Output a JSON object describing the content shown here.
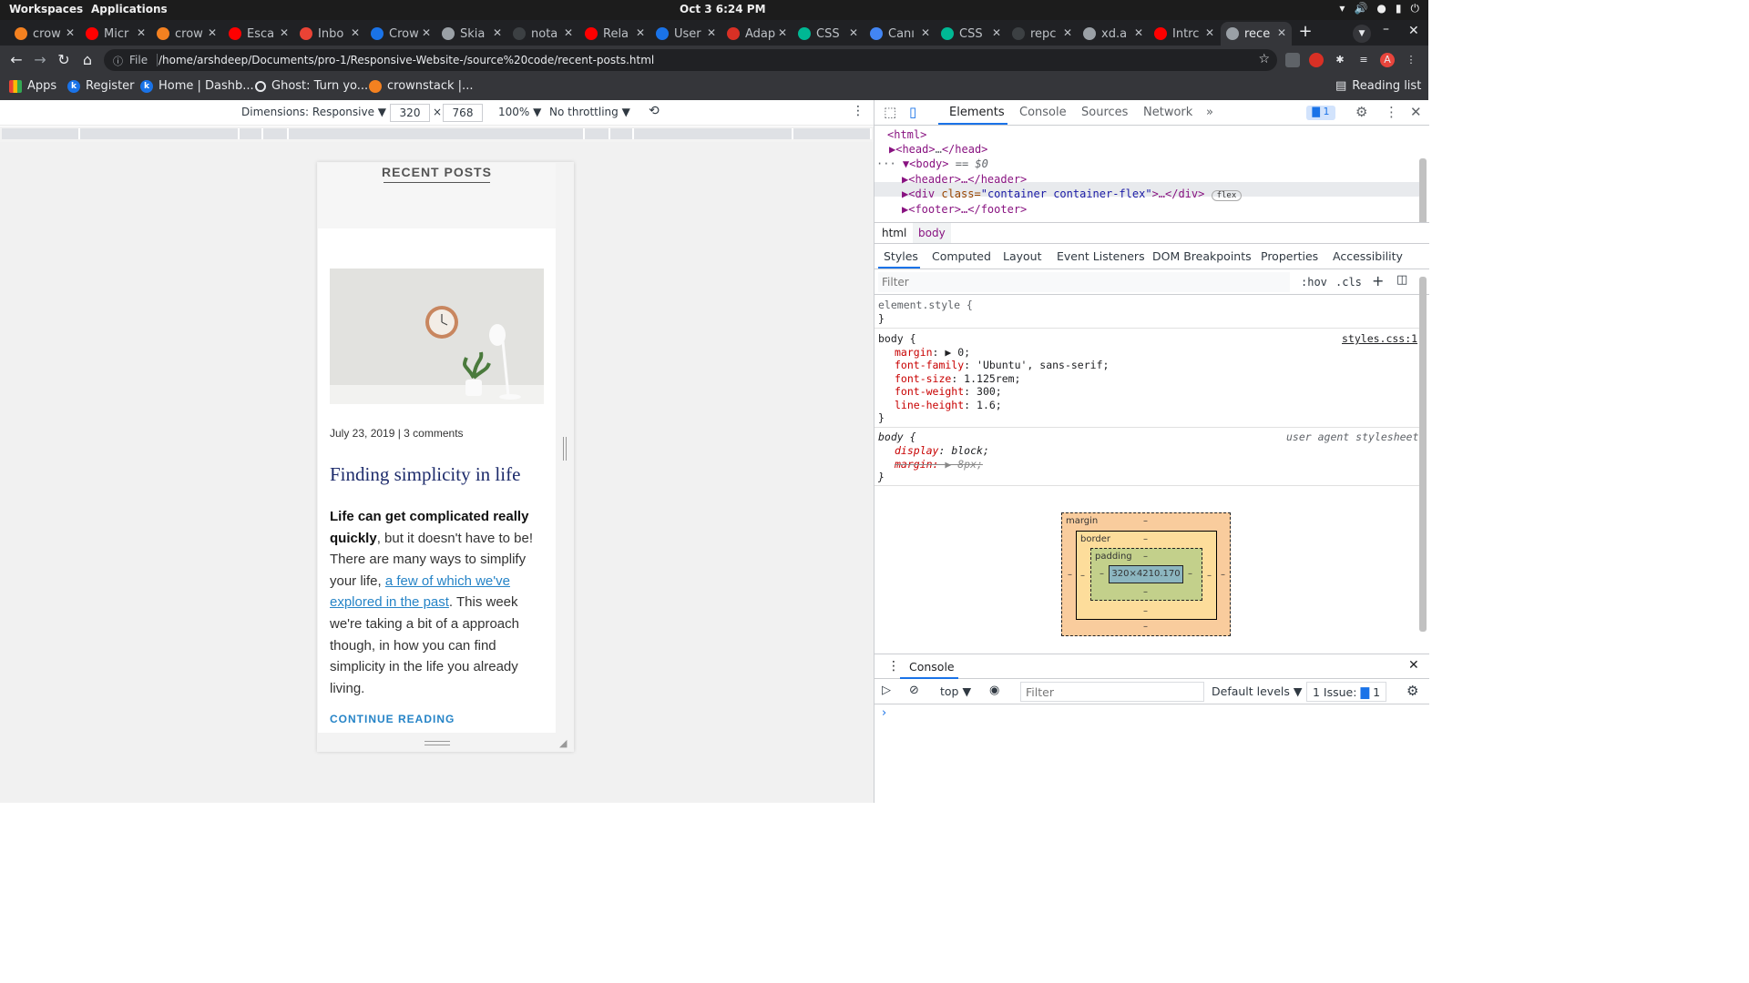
{
  "system": {
    "workspaces": "Workspaces",
    "applications": "Applications",
    "clock": "Oct 3   6:24 PM"
  },
  "tabs": [
    {
      "title": "crow",
      "color": "#f48120"
    },
    {
      "title": "Micr",
      "color": "#ff0000"
    },
    {
      "title": "crow",
      "color": "#f48120"
    },
    {
      "title": "Esca",
      "color": "#ff0000"
    },
    {
      "title": "Inbo",
      "color": "#ea4335"
    },
    {
      "title": "Crow",
      "color": "#1a73e8"
    },
    {
      "title": "Skia",
      "color": "#9aa0a6"
    },
    {
      "title": "nota",
      "color": "#3c4043"
    },
    {
      "title": "Rela",
      "color": "#ff0000"
    },
    {
      "title": "User",
      "color": "#1a73e8"
    },
    {
      "title": "Adap",
      "color": "#d93025"
    },
    {
      "title": "CSS",
      "color": "#00b894"
    },
    {
      "title": "Canı",
      "color": "#4285f4"
    },
    {
      "title": "CSS",
      "color": "#00b894"
    },
    {
      "title": "repc",
      "color": "#3c4043"
    },
    {
      "title": "xd.a",
      "color": "#9aa0a6"
    },
    {
      "title": "Intrc",
      "color": "#ff0000"
    },
    {
      "title": "rece",
      "color": "#9aa0a6",
      "active": true
    }
  ],
  "omnibox": {
    "info": "ⓘ",
    "file": "File",
    "url": "/home/arshdeep/Documents/pro-1/Responsive-Website-/source%20code/recent-posts.html"
  },
  "bookmarks": [
    {
      "label": "Apps",
      "color": "#4285f4"
    },
    {
      "label": "Register",
      "color": "#1a73e8"
    },
    {
      "label": "Home | Dashb...",
      "color": "#1a73e8"
    },
    {
      "label": "Ghost: Turn yo...",
      "color": "#3c4043"
    },
    {
      "label": "crownstack |...",
      "color": "#f48120"
    }
  ],
  "reading_list": "Reading list",
  "device": {
    "dimensions": "Dimensions: Responsive ▼",
    "width": "320",
    "times": "×",
    "height": "768",
    "zoom": "100% ▼",
    "throttle": "No throttling ▼"
  },
  "page": {
    "heading": "RECENT POSTS",
    "meta": "July 23, 2019 | 3 comments",
    "title": "Finding simplicity in life",
    "bold": "Life can get complicated really quickly",
    "text1": ", but it doesn't have to be! There are many ways to simplify your life, ",
    "link": "a few of which we've explored in the past",
    "text2": ". This week we're taking a bit of a approach though, in how you can find simplicity in the life you already living.",
    "continue": "CONTINUE READING"
  },
  "devtools": {
    "tabs": [
      "Elements",
      "Console",
      "Sources",
      "Network",
      "»"
    ],
    "issues": "1",
    "tree": {
      "html": "<html>",
      "head_open": "<head>",
      "head_dots": "…",
      "head_close": "</head>",
      "body": "<body>",
      "eq": " == $0",
      "header": "<header>…</header>",
      "div_open": "<div ",
      "div_attr": "class=",
      "div_val": "\"container container-flex\"",
      "div_close": ">…</div>",
      "flex": "flex",
      "footer": "<footer>…</footer>"
    },
    "crumbs": [
      "html",
      "body"
    ],
    "subtabs": [
      "Styles",
      "Computed",
      "Layout",
      "Event Listeners",
      "DOM Breakpoints",
      "Properties",
      "Accessibility"
    ],
    "filter": "Filter",
    "hov": ":hov",
    "cls": ".cls",
    "styles": {
      "element": "element.style {",
      "close": "}",
      "body_sel": "body {",
      "source": "styles.css:1",
      "rules": [
        {
          "p": "margin",
          "v": "▶ 0;"
        },
        {
          "p": "font-family",
          "v": "'Ubuntu', sans-serif;"
        },
        {
          "p": "font-size",
          "v": "1.125rem;"
        },
        {
          "p": "font-weight",
          "v": "300;"
        },
        {
          "p": "line-height",
          "v": "1.6;"
        }
      ],
      "ua_sel": "body {",
      "ua_source": "user agent stylesheet",
      "ua_rules": [
        {
          "p": "display",
          "v": "block;"
        },
        {
          "p": "margin:",
          "v": "▶ 8px;"
        }
      ]
    },
    "boxmodel": {
      "margin": "margin",
      "border": "border",
      "padding": "padding",
      "dash": "–",
      "content": "320×4210.170"
    },
    "console": {
      "title": "Console",
      "top": "top ▼",
      "filter": "Filter",
      "levels": "Default levels ▼",
      "issue": "1 Issue:",
      "issue_count": "1"
    }
  }
}
